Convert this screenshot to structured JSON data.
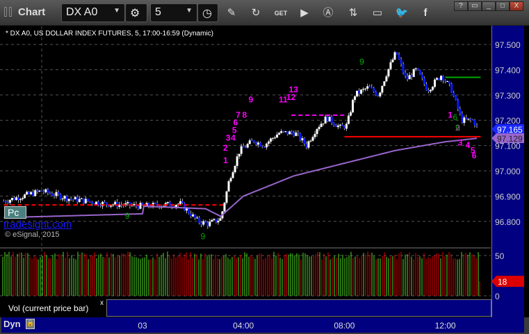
{
  "window": {
    "title": "Chart",
    "symbol": "DX A0",
    "interval": "5",
    "help": "?",
    "minimize": "_",
    "maximize": "□",
    "close": "X"
  },
  "toolbar_icons": [
    "settings-icon",
    "clock-icon",
    "pencil-icon",
    "refresh-icon",
    "get-icon",
    "play-icon",
    "alert-icon",
    "link-icon",
    "comment-icon",
    "twitter-icon",
    "facebook-icon"
  ],
  "legend": "* DX A0, US DOLLAR INDEX FUTURES, 5, 17:00-16:59 (Dynamic)",
  "badge_pc": "Pc",
  "watermark": "tradesight.com",
  "copyright": "© eSignal, 2015",
  "colors": {
    "up": "#ffffff",
    "down": "#0a1aff",
    "ma": "#9966cc",
    "red_line": "#ff0000",
    "magenta": "#ff00ff",
    "green": "#008000",
    "axis_bg": "#000080"
  },
  "chart_data": {
    "type": "candlestick",
    "ylim": [
      96.75,
      97.55
    ],
    "price_ticks": [
      "97.500",
      "97.400",
      "97.300",
      "97.200",
      "97.100",
      "97.000",
      "96.900",
      "96.800"
    ],
    "last_price": "97.165",
    "ma_value": "97.129",
    "x_ticks": [
      {
        "label": "03",
        "hour": 0
      },
      {
        "label": "04:00",
        "hour": 4
      },
      {
        "label": "08:00",
        "hour": 8
      },
      {
        "label": "12:00",
        "hour": 12
      }
    ],
    "price_path": [
      [
        -5.5,
        96.88
      ],
      [
        -4.0,
        96.92
      ],
      [
        -2.9,
        96.89
      ],
      [
        -1.5,
        96.87
      ],
      [
        0,
        96.86
      ],
      [
        1.5,
        96.87
      ],
      [
        2.2,
        96.8
      ],
      [
        2.6,
        96.79
      ],
      [
        3.1,
        96.81
      ],
      [
        3.45,
        96.97
      ],
      [
        3.85,
        97.08
      ],
      [
        4.4,
        97.12
      ],
      [
        4.8,
        97.1
      ],
      [
        5.4,
        97.15
      ],
      [
        6.05,
        97.15
      ],
      [
        6.5,
        97.1
      ],
      [
        6.9,
        97.17
      ],
      [
        7.3,
        97.21
      ],
      [
        7.85,
        97.17
      ],
      [
        8.1,
        97.18
      ],
      [
        8.4,
        97.3
      ],
      [
        8.95,
        97.33
      ],
      [
        9.35,
        97.3
      ],
      [
        9.65,
        97.38
      ],
      [
        10.05,
        97.47
      ],
      [
        10.45,
        97.36
      ],
      [
        10.85,
        97.4
      ],
      [
        11.3,
        97.32
      ],
      [
        11.85,
        97.38
      ],
      [
        12.25,
        97.32
      ],
      [
        12.65,
        97.2
      ],
      [
        13.1,
        97.2
      ],
      [
        13.3,
        97.165
      ]
    ],
    "ma_path": [
      [
        -5.5,
        96.815
      ],
      [
        0,
        96.83
      ],
      [
        0.05,
        96.86
      ],
      [
        2.5,
        96.85
      ],
      [
        3.1,
        96.82
      ],
      [
        4,
        96.9
      ],
      [
        6,
        96.98
      ],
      [
        8,
        97.03
      ],
      [
        10,
        97.08
      ],
      [
        12,
        97.115
      ],
      [
        13.3,
        97.129
      ]
    ],
    "lines": [
      {
        "kind": "red-dashed",
        "price": 96.865,
        "from": -5.5,
        "to": 3.2
      },
      {
        "kind": "magenta-dashed",
        "price": 97.22,
        "from": 5.9,
        "to": 8.0
      },
      {
        "kind": "red-solid",
        "price": 97.135,
        "from": 8.0,
        "to": 13.4
      },
      {
        "kind": "green-solid",
        "price": 97.37,
        "from": 12.0,
        "to": 13.4
      }
    ],
    "markers": [
      {
        "t": "1",
        "h": 3.2,
        "p": 97.03,
        "c": "m"
      },
      {
        "t": "2",
        "h": 3.2,
        "p": 97.08,
        "c": "m"
      },
      {
        "t": "3",
        "h": 3.3,
        "p": 97.12,
        "c": "m"
      },
      {
        "t": "4",
        "h": 3.5,
        "p": 97.12,
        "c": "m"
      },
      {
        "t": "5",
        "h": 3.55,
        "p": 97.15,
        "c": "m"
      },
      {
        "t": "6",
        "h": 3.6,
        "p": 97.18,
        "c": "m"
      },
      {
        "t": "7",
        "h": 3.7,
        "p": 97.21,
        "c": "m"
      },
      {
        "t": "8",
        "h": 3.95,
        "p": 97.21,
        "c": "m"
      },
      {
        "t": "9",
        "h": 4.2,
        "p": 97.27,
        "c": "m"
      },
      {
        "t": "11",
        "h": 5.4,
        "p": 97.27,
        "c": "m"
      },
      {
        "t": "12",
        "h": 5.7,
        "p": 97.28,
        "c": "m"
      },
      {
        "t": "13",
        "h": 5.8,
        "p": 97.31,
        "c": "m"
      },
      {
        "t": "1",
        "h": 12.1,
        "p": 97.21,
        "c": "m"
      },
      {
        "t": "2",
        "h": 12.4,
        "p": 97.16,
        "c": "m"
      },
      {
        "t": "3",
        "h": 12.5,
        "p": 97.1,
        "c": "m"
      },
      {
        "t": "4",
        "h": 12.8,
        "p": 97.09,
        "c": "m"
      },
      {
        "t": "5",
        "h": 13.0,
        "p": 97.07,
        "c": "m"
      },
      {
        "t": "6",
        "h": 13.05,
        "p": 97.05,
        "c": "m"
      },
      {
        "t": "9",
        "h": 8.6,
        "p": 97.42,
        "c": "g"
      },
      {
        "t": "6",
        "h": 12.3,
        "p": 97.2,
        "c": "g"
      },
      {
        "t": "9",
        "h": 12.4,
        "p": 97.16,
        "c": "g"
      },
      {
        "t": "9",
        "h": -0.7,
        "p": 96.81,
        "c": "g"
      },
      {
        "t": "9",
        "h": 2.3,
        "p": 96.73,
        "c": "g"
      }
    ],
    "volume": {
      "ylim": [
        0,
        60
      ],
      "ticks": [
        "50",
        "0"
      ],
      "last": "18"
    }
  },
  "panes": {
    "vol_label": "Vol (current price bar)",
    "vol_close": "x"
  },
  "footer": {
    "dyn": "Dyn"
  }
}
